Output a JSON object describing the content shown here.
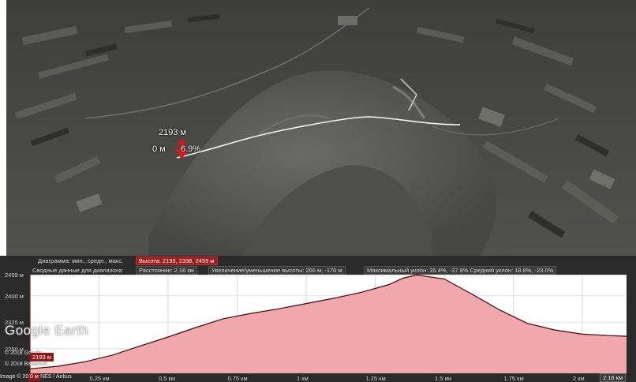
{
  "map": {
    "marker_elevation": "2193 м",
    "marker_distance": "0 м",
    "marker_slope": "6.9%"
  },
  "profile_header": {
    "diagram_label": "Диаграмма: мин., средн., макс.",
    "elevation_box": "Высота: 2193, 2338, 2459 м",
    "summary_label": "Сводные данные для диапазона:",
    "distance_box": "Расстояние: 2.16 км",
    "gain_box": "Увеличение/уменьшение высоты: 266 м, -176 м",
    "slope_box": "Максимальный уклон: 35.4%, -37.8% Средний уклон: 18.8%, -23.0%"
  },
  "overlay": {
    "logo": "Google Earth",
    "credit_1": "© 2018 Google",
    "credit_2": "© 2018 Basarsoft",
    "credit_3": "Image © 2018 CNES / Airbus",
    "cursor_value": "2193 м",
    "cursor_x": "0 м",
    "end_x": "2.16 км"
  },
  "chart_data": {
    "type": "area",
    "y_tick_labels": [
      "2459 м",
      "2400 м",
      "2325 м",
      "2250 м"
    ],
    "y_ticks": [
      2459,
      2400,
      2325,
      2250
    ],
    "x_tick_labels": [
      "0.25 км",
      "0.5 км",
      "0.75 км",
      "1 км",
      "1.25 км",
      "1.5 км",
      "1.75 км",
      "2 км"
    ],
    "x_ticks": [
      0.25,
      0.5,
      0.75,
      1.0,
      1.25,
      1.5,
      1.75,
      2.0
    ],
    "xlim": [
      0,
      2.16
    ],
    "ylim": [
      2180,
      2460
    ],
    "x": [
      0,
      0.1,
      0.2,
      0.3,
      0.4,
      0.5,
      0.6,
      0.7,
      0.8,
      0.9,
      1.0,
      1.1,
      1.2,
      1.3,
      1.35,
      1.4,
      1.5,
      1.6,
      1.7,
      1.8,
      1.9,
      2.0,
      2.1,
      2.16
    ],
    "y": [
      2193,
      2200,
      2213,
      2232,
      2258,
      2283,
      2310,
      2335,
      2350,
      2363,
      2378,
      2393,
      2410,
      2432,
      2450,
      2459,
      2448,
      2405,
      2360,
      2322,
      2303,
      2291,
      2287,
      2285
    ],
    "line_color": "#3a0a0a",
    "fill_color": "#f0a8ac",
    "grid": true
  }
}
